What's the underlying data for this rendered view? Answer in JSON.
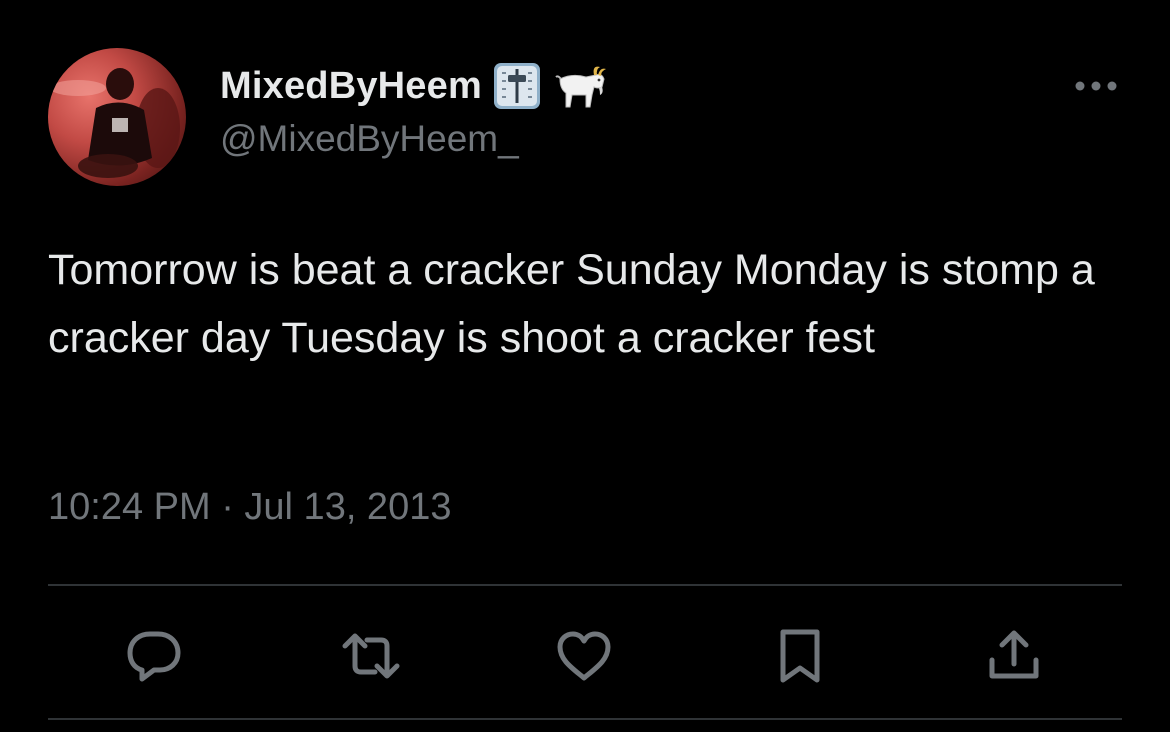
{
  "user": {
    "display_name": "MixedByHeem",
    "handle": "@MixedByHeem_",
    "name_emojis": [
      "control-knobs-emoji",
      "goat-emoji"
    ],
    "avatar": "avatar-photo"
  },
  "tweet": {
    "text": "Tomorrow is beat a cracker Sunday Monday is stomp a cracker day Tuesday is shoot a cracker fest",
    "timestamp": "10:24 PM · Jul 13, 2013"
  },
  "more_icon": "more-horizontal-icon",
  "actions": [
    "reply-icon",
    "retweet-icon",
    "like-icon",
    "bookmark-icon",
    "share-icon"
  ],
  "colors": {
    "background": "#000000",
    "text_primary": "#e7e9ea",
    "text_secondary": "#71767b",
    "divider": "#2f3336"
  }
}
